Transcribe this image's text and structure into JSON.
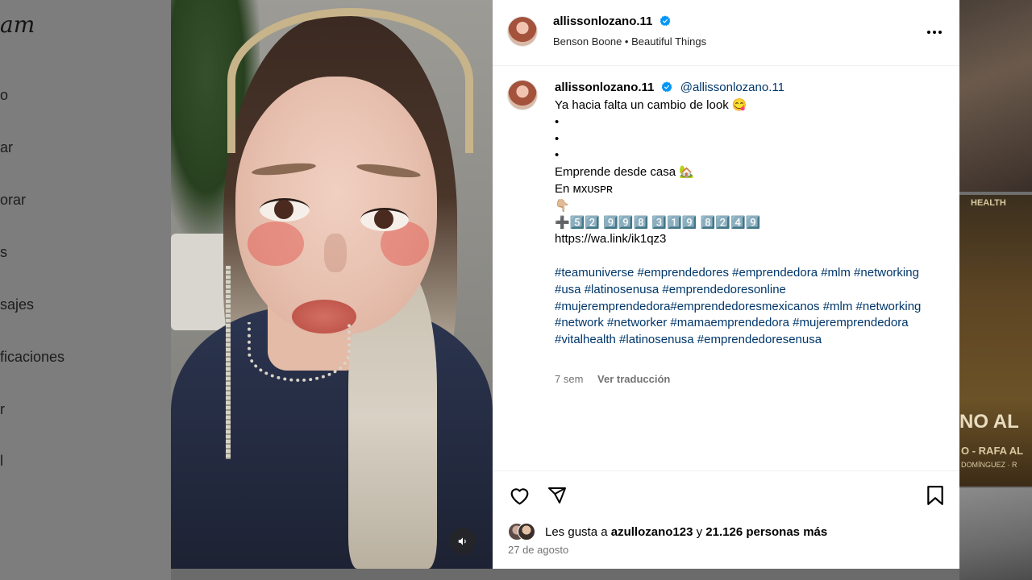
{
  "background": {
    "logo_fragment": "am",
    "nav_fragments": [
      "o",
      "ar",
      "orar",
      "s",
      "sajes",
      "ficaciones",
      "r",
      "l"
    ],
    "tile_texts": [
      "HEALTH",
      "NO AL",
      "O - RAFA AL",
      "DOMÍNGUEZ · R"
    ]
  },
  "post": {
    "username": "allissonlozano.11",
    "music_artist": "Benson Boone",
    "music_separator": "•",
    "music_title": "Beautiful Things",
    "caption": {
      "username": "allissonlozano.11",
      "mention": "@allissonlozano.11",
      "lines": [
        "Ya hacia falta un cambio de look 😋",
        "•",
        "•",
        "•",
        "Emprende desde casa 🏡",
        "En ᴍxᴜsᴘʀ",
        "👇🏼",
        "➕5️⃣2️⃣ 9️⃣9️⃣8️⃣ 3️⃣1️⃣9️⃣ 8️⃣2️⃣4️⃣9️⃣",
        "https://wa.link/ik1qz3",
        ""
      ],
      "hashtags": "#teamuniverse #emprendedores #emprendedora #mlm #networking #usa #latinosenusa #emprendedoresonline #mujeremprendedora#emprendedoresmexicanos #mlm #networking #network #networker #mamaemprendedora #mujeremprendedora #vitalhealth #latinosenusa #emprendedoresenusa",
      "age": "7 sem",
      "translate_label": "Ver traducción"
    },
    "likes": {
      "prefix": "Les gusta a",
      "user": "azullozano123",
      "conjunction": "y",
      "count_text": "21.126 personas más"
    },
    "date": "27 de agosto",
    "icons": {
      "verified": "verified-badge-icon",
      "more": "more-options-icon",
      "like": "heart-icon",
      "share": "send-icon",
      "save": "bookmark-icon",
      "mute": "speaker-icon"
    },
    "colors": {
      "verified": "#0095f6",
      "link": "#00376b",
      "secondary_text": "#737373"
    }
  }
}
